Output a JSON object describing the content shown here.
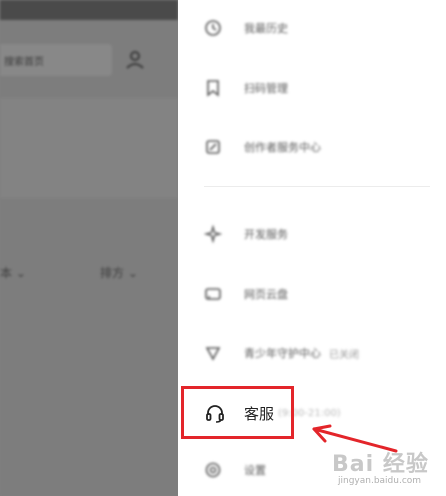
{
  "background_app": {
    "search_text": "搜索首页",
    "row_left": "本 ⌄",
    "row_right": "排方 ⌄"
  },
  "drawer": {
    "items": [
      {
        "label": "我最历史",
        "icon": "clock-icon"
      },
      {
        "label": "扫码管理",
        "icon": "bookmark-icon"
      },
      {
        "label": "创作者服务中心",
        "icon": "editor-icon"
      },
      {
        "label": "开发服务",
        "icon": "sparkle-icon"
      },
      {
        "label": "网页云盘",
        "icon": "cloud-icon"
      },
      {
        "label": "青少年守护中心",
        "sub": "已关闭",
        "icon": "shield-icon"
      }
    ],
    "customer_service": {
      "label": "客服",
      "sub": "(9:00-21:00)",
      "icon": "headset-icon"
    },
    "settings": {
      "label": "设置",
      "icon": "gear-icon"
    }
  },
  "annotation": {
    "highlight_color": "#e3252a"
  },
  "watermark": {
    "main": "Bai 经验",
    "sub": "jingyan.baidu.com"
  }
}
